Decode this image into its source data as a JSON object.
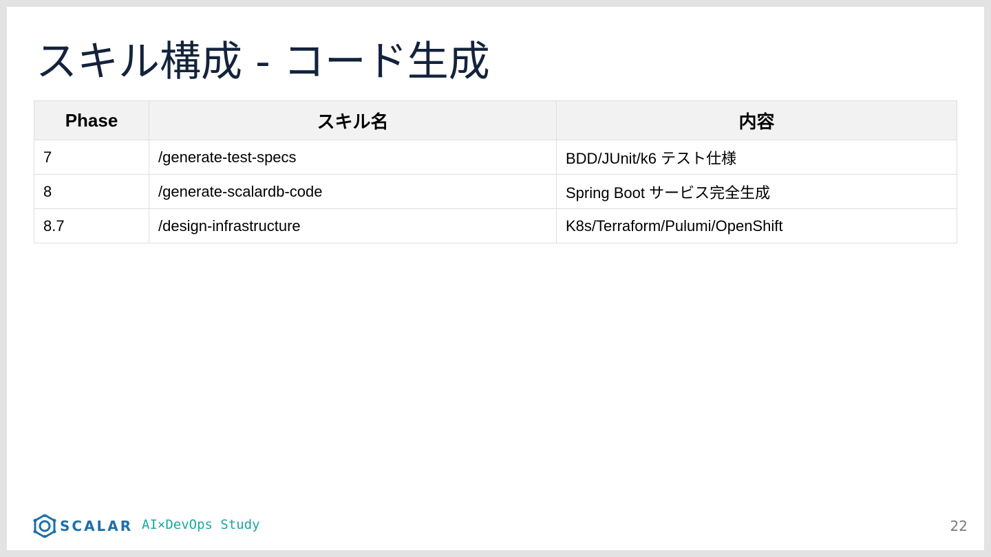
{
  "slide": {
    "title": "スキル構成 - コード生成",
    "page_number": "22"
  },
  "table": {
    "headers": [
      "Phase",
      "スキル名",
      "内容"
    ],
    "rows": [
      [
        "7",
        "/generate-test-specs",
        "BDD/JUnit/k6 テスト仕様"
      ],
      [
        "8",
        "/generate-scalardb-code",
        "Spring Boot サービス完全生成"
      ],
      [
        "8.7",
        "/design-infrastructure",
        "K8s/Terraform/Pulumi/OpenShift"
      ]
    ]
  },
  "footer": {
    "brand": "SCALAR",
    "tagline": "AI×DevOps Study",
    "logo_icon": "scalar-logo-icon",
    "brand_color": "#1e6fa8",
    "tagline_color": "#1aa7a0"
  }
}
